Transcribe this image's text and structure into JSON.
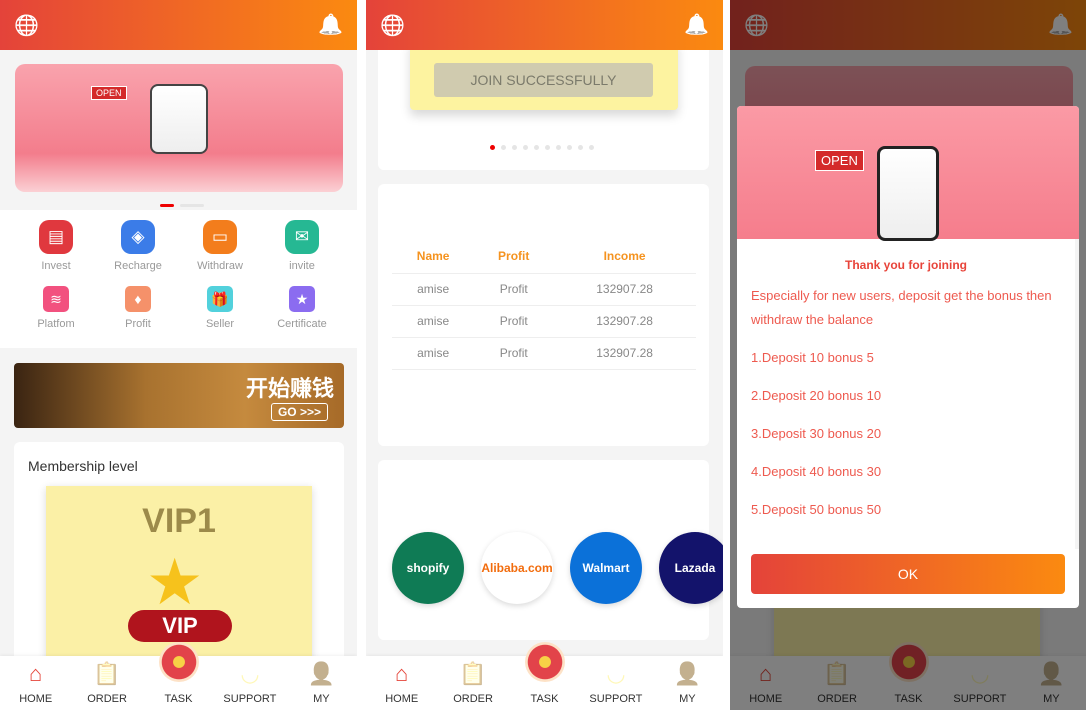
{
  "header": {
    "globe_icon": "globe-icon",
    "bell_icon": "bell-icon"
  },
  "tabs": [
    {
      "label": "HOME",
      "icon": "home-icon"
    },
    {
      "label": "ORDER",
      "icon": "clipboard-icon"
    },
    {
      "label": "TASK",
      "icon": "coin-icon"
    },
    {
      "label": "SUPPORT",
      "icon": "headset-icon"
    },
    {
      "label": "MY",
      "icon": "user-icon"
    }
  ],
  "home": {
    "banner_open": "OPEN",
    "grid": [
      {
        "label": "Invest",
        "color": "#e0383e"
      },
      {
        "label": "Recharge",
        "color": "#3b7ce8"
      },
      {
        "label": "Withdraw",
        "color": "#f37d1c"
      },
      {
        "label": "invite",
        "color": "#26b893"
      },
      {
        "label": "Platfom",
        "color": "#f2517f"
      },
      {
        "label": "Profit",
        "color": "#f5916a"
      },
      {
        "label": "Seller",
        "color": "#52d1dc"
      },
      {
        "label": "Certificate",
        "color": "#8b6cf0"
      }
    ],
    "promo_text": "开始赚钱",
    "promo_go": "GO >>>",
    "membership_title": "Membership level",
    "vip_level": "VIP1",
    "vip_badge": "VIP"
  },
  "task": {
    "join_button": "JOIN SUCCESSFULLY",
    "table": {
      "headers": [
        "Name",
        "Profit",
        "Income"
      ],
      "rows": [
        [
          "amise",
          "Profit",
          "132907.28"
        ],
        [
          "amise",
          "Profit",
          "132907.28"
        ],
        [
          "amise",
          "Profit",
          "132907.28"
        ]
      ]
    },
    "partners": [
      {
        "name": "shopify",
        "color": "#0f7b55"
      },
      {
        "name": "Alibaba.com",
        "color": "#ffffff"
      },
      {
        "name": "Walmart",
        "color": "#0b71d9"
      },
      {
        "name": "Lazada",
        "color": "#13136b"
      }
    ]
  },
  "modal": {
    "banner_open": "OPEN",
    "title": "Thank you for joining",
    "intro": "Especially for new users, deposit get the bonus then withdraw the balance",
    "items": [
      "1.Deposit 10 bonus 5",
      "2.Deposit 20 bonus 10",
      "3.Deposit 30 bonus 20",
      "4.Deposit 40 bonus 30",
      "5.Deposit 50 bonus 50"
    ],
    "ok_label": "OK"
  }
}
